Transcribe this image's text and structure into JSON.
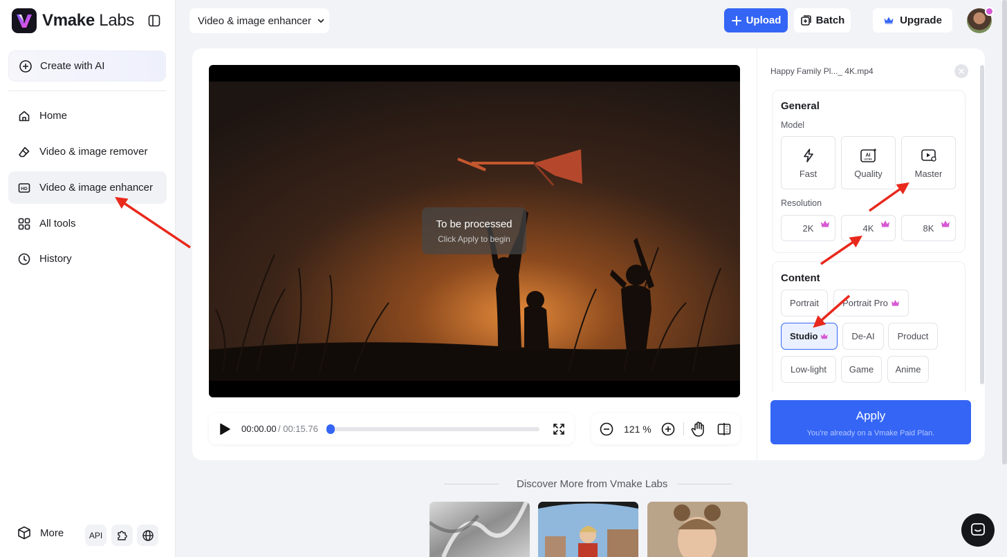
{
  "brand": {
    "name_bold": "Vmake",
    "name_light": "Labs"
  },
  "sidebar": {
    "create_label": "Create with AI",
    "items": [
      {
        "label": "Home",
        "icon": "home-icon"
      },
      {
        "label": "Video & image remover",
        "icon": "eraser-icon"
      },
      {
        "label": "Video & image enhancer",
        "icon": "hd-icon",
        "active": true
      },
      {
        "label": "All tools",
        "icon": "grid-icon"
      },
      {
        "label": "History",
        "icon": "clock-icon"
      }
    ],
    "more_label": "More",
    "api_label": "API"
  },
  "topbar": {
    "tool_select": "Video & image enhancer",
    "upload_label": "Upload",
    "batch_label": "Batch",
    "upgrade_label": "Upgrade"
  },
  "video": {
    "overlay_title": "To be processed",
    "overlay_hint": "Click Apply to begin"
  },
  "player": {
    "current_time": "00:00.00",
    "total_time": "/ 00:15.76",
    "progress": 0.0
  },
  "zoom": {
    "value": "121 %"
  },
  "panel": {
    "file_name": "Happy Family Pl..._ 4K.mp4",
    "general_title": "General",
    "model_label": "Model",
    "models": [
      {
        "label": "Fast",
        "icon": "lightning-icon"
      },
      {
        "label": "Quality",
        "icon": "ai-ultra-icon"
      },
      {
        "label": "Master",
        "icon": "video-badge-icon"
      }
    ],
    "resolution_label": "Resolution",
    "resolutions": [
      {
        "label": "2K",
        "premium": true
      },
      {
        "label": "4K",
        "premium": true
      },
      {
        "label": "8K",
        "premium": true
      }
    ],
    "content_title": "Content",
    "content_chips": [
      {
        "label": "Portrait",
        "premium": false
      },
      {
        "label": "Portrait Pro",
        "premium": true
      },
      {
        "label": "Studio",
        "premium": true,
        "selected": true
      },
      {
        "label": "De-AI",
        "premium": false
      },
      {
        "label": "Product",
        "premium": false
      },
      {
        "label": "Low-light",
        "premium": false
      },
      {
        "label": "Game",
        "premium": false
      },
      {
        "label": "Anime",
        "premium": false
      }
    ],
    "apply_label": "Apply",
    "apply_note": "You're already on a Vmake Paid Plan."
  },
  "discover": {
    "title": "Discover More from Vmake Labs"
  },
  "colors": {
    "accent": "#3465f5",
    "premium": "#d65ad3",
    "annotation_arrow": "#e8291c"
  }
}
